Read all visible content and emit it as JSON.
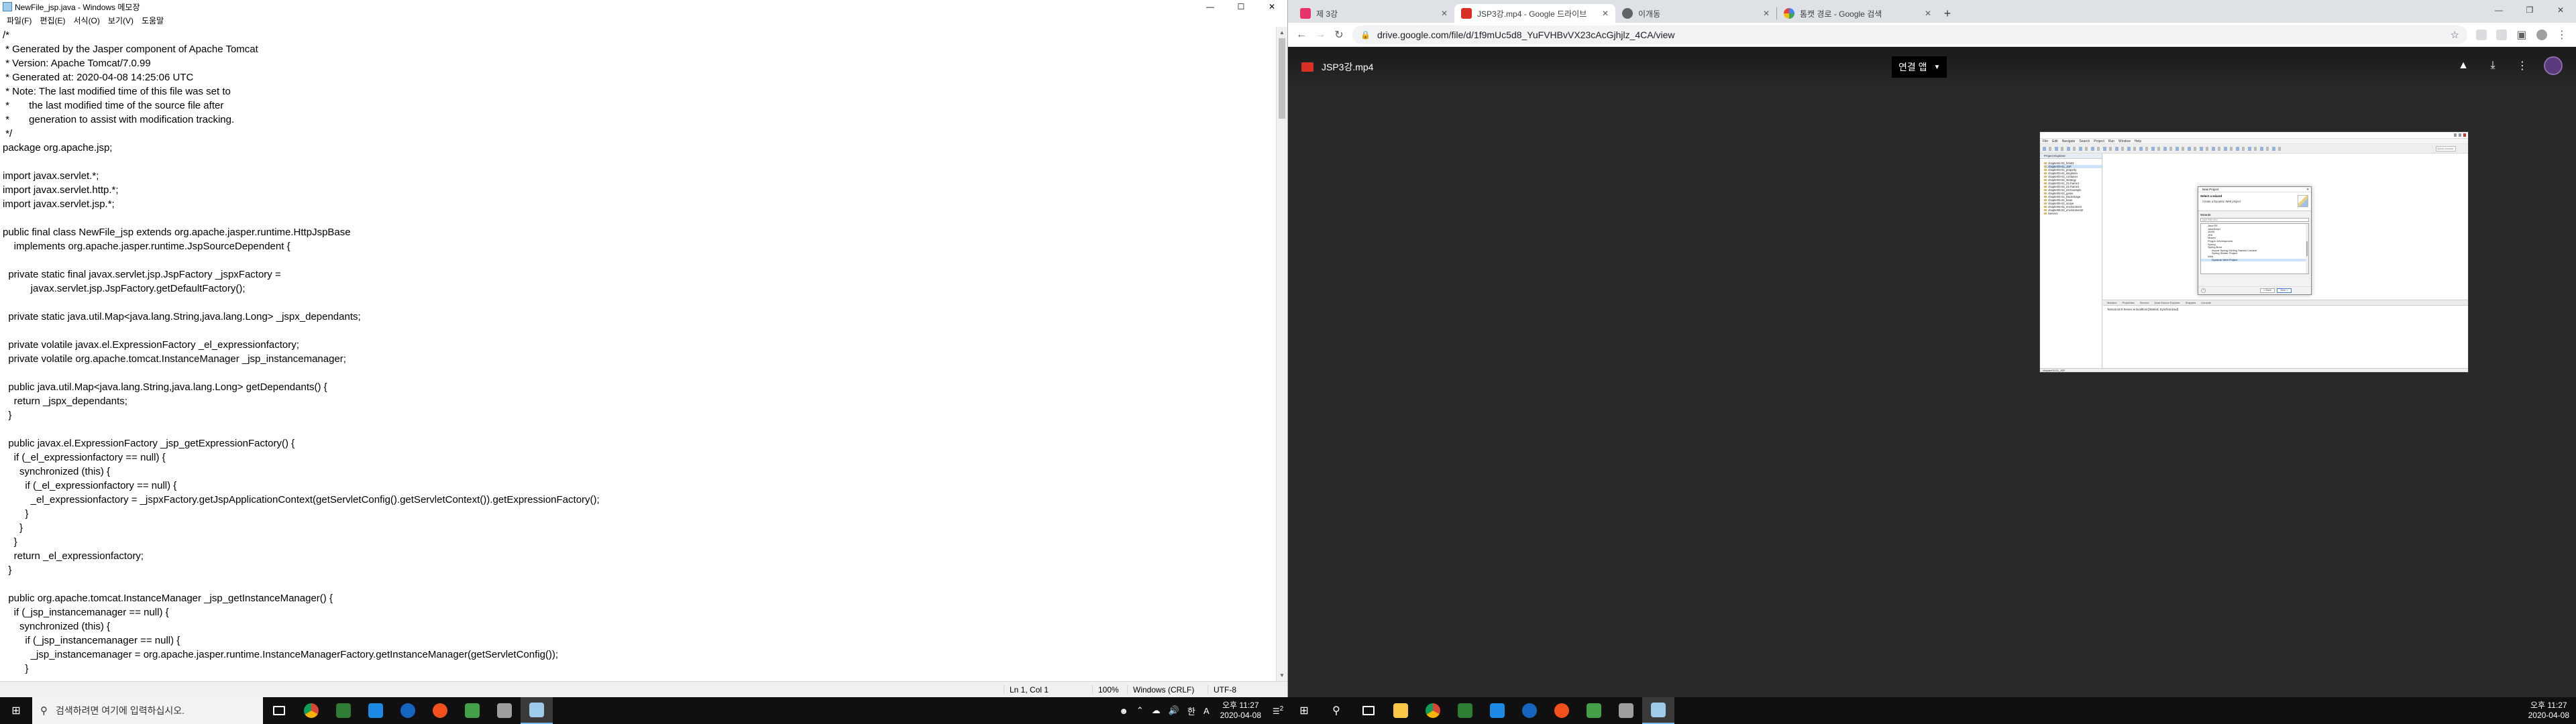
{
  "notepad": {
    "title": "NewFile_jsp.java - Windows 메모장",
    "menu": [
      "파일(F)",
      "편집(E)",
      "서식(O)",
      "보기(V)",
      "도움말"
    ],
    "lines": [
      "/*",
      " * Generated by the Jasper component of Apache Tomcat",
      " * Version: Apache Tomcat/7.0.99",
      " * Generated at: 2020-04-08 14:25:06 UTC",
      " * Note: The last modified time of this file was set to",
      " *       the last modified time of the source file after",
      " *       generation to assist with modification tracking.",
      " */",
      "package org.apache.jsp;",
      "",
      "import javax.servlet.*;",
      "import javax.servlet.http.*;",
      "import javax.servlet.jsp.*;",
      "",
      "public final class NewFile_jsp extends org.apache.jasper.runtime.HttpJspBase",
      "    implements org.apache.jasper.runtime.JspSourceDependent {",
      "",
      "  private static final javax.servlet.jsp.JspFactory _jspxFactory =",
      "          javax.servlet.jsp.JspFactory.getDefaultFactory();",
      "",
      "  private static java.util.Map<java.lang.String,java.lang.Long> _jspx_dependants;",
      "",
      "  private volatile javax.el.ExpressionFactory _el_expressionfactory;",
      "  private volatile org.apache.tomcat.InstanceManager _jsp_instancemanager;",
      "",
      "  public java.util.Map<java.lang.String,java.lang.Long> getDependants() {",
      "    return _jspx_dependants;",
      "  }",
      "",
      "  public javax.el.ExpressionFactory _jsp_getExpressionFactory() {",
      "    if (_el_expressionfactory == null) {",
      "      synchronized (this) {",
      "        if (_el_expressionfactory == null) {",
      "          _el_expressionfactory = _jspxFactory.getJspApplicationContext(getServletConfig().getServletContext()).getExpressionFactory();",
      "        }",
      "      }",
      "    }",
      "    return _el_expressionfactory;",
      "  }",
      "",
      "  public org.apache.tomcat.InstanceManager _jsp_getInstanceManager() {",
      "    if (_jsp_instancemanager == null) {",
      "      synchronized (this) {",
      "        if (_jsp_instancemanager == null) {",
      "          _jsp_instancemanager = org.apache.jasper.runtime.InstanceManagerFactory.getInstanceManager(getServletConfig());",
      "        }"
    ],
    "status": {
      "position": "Ln 1, Col 1",
      "zoom": "100%",
      "eol": "Windows (CRLF)",
      "encoding": "UTF-8"
    }
  },
  "taskbar_left": {
    "search_placeholder": "검색하려면 여기에 입력하십시오.",
    "time": "오후 11:27",
    "date": "2020-04-08",
    "lang": "A",
    "ime": "한",
    "notifications": "2"
  },
  "taskbar_right": {
    "time": "오후 11:27",
    "date": "2020-04-08"
  },
  "chrome": {
    "tabs": [
      {
        "label": "제 3강",
        "favicon_color": "#e8336d",
        "active": false
      },
      {
        "label": "JSP3강.mp4 - Google 드라이브",
        "favicon_color": "#d93025",
        "active": true
      },
      {
        "label": "이개동",
        "favicon_color": "#5f6368",
        "active": false
      },
      {
        "label": "톰캣 경로 - Google 검색",
        "favicon_color": "#4285f4",
        "active": false
      }
    ],
    "url": "drive.google.com/file/d/1f9mUc5d8_YuFVHBvVX23cAcGjhjlz_4CA/view",
    "viewer": {
      "file_name": "JSP3강.mp4",
      "open_with": "연결 앱"
    }
  },
  "video": {
    "menu": [
      "File",
      "Edit",
      "Navigate",
      "Search",
      "Project",
      "Run",
      "Window",
      "Help"
    ],
    "quick_access": "Quick Access",
    "project_explorer": {
      "header": "Project Explorer",
      "items": [
        "chapter02-01_first03",
        "chapter03-01_JSP",
        "chapter03-01_property",
        "chapter03-01_singleton",
        "chapter03-02_container",
        "chapter03-02_strategy",
        "chapter03-01_Z1-frame1",
        "chapter03-02_Z1-frame2",
        "chapter03-02_Z2-Example",
        "chapter04-02_game",
        "chapter04-01_DuckImage",
        "chapter05-01_bean",
        "chapter05-02_scope",
        "chapter06-01_environment",
        "chapter06-02_environment2",
        "Servers"
      ],
      "selected_index": 1,
      "status": "chapter03-01_JSP"
    },
    "bottom_tabs": [
      "Markers",
      "Properties",
      "Servers",
      "Data Source Explorer",
      "Snippets",
      "Console"
    ],
    "server_line": "Tomcat v8.0 Server at localhost  [Started, Synchronized]",
    "dialog": {
      "title": "New Project",
      "heading": "Select a wizard",
      "subheading": "Create a Dynamic Web project",
      "wizards_label": "Wizards:",
      "filter_placeholder": "type filter text",
      "tree": [
        {
          "label": "Java EE",
          "sub": false
        },
        {
          "label": "JavaScript",
          "sub": false
        },
        {
          "label": "JAXB",
          "sub": false
        },
        {
          "label": "JPA",
          "sub": false
        },
        {
          "label": "Maven",
          "sub": false
        },
        {
          "label": "Plug-in Development",
          "sub": false
        },
        {
          "label": "Spring",
          "sub": false
        },
        {
          "label": "Spring Boot",
          "sub": false
        },
        {
          "label": "Import Spring Getting Started Content",
          "sub": true
        },
        {
          "label": "Spring Starter Project",
          "sub": true
        },
        {
          "label": "Web",
          "sub": false
        },
        {
          "label": "Dynamic Web Project",
          "sub": true,
          "selected": true
        }
      ],
      "buttons": {
        "help": "?",
        "back": "< Back",
        "next": "Next >",
        "finish": "Finish",
        "cancel": "Cancel"
      }
    }
  }
}
